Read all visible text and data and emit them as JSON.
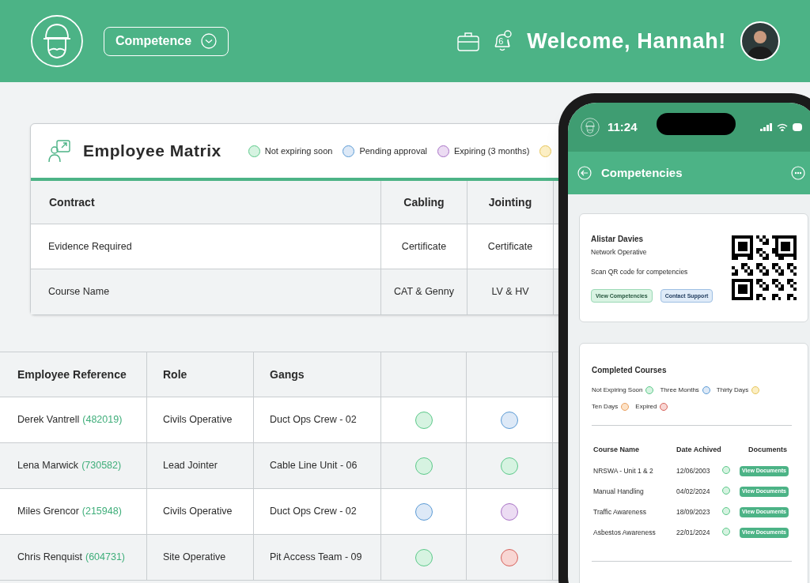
{
  "header": {
    "module_selector": {
      "label": "Competence"
    },
    "notifications": {
      "count": "6"
    },
    "greeting": "Welcome, Hannah!"
  },
  "matrix": {
    "title": "Employee Matrix",
    "legend": [
      {
        "label": "Not expiring soon",
        "color": "#d6f3e1"
      },
      {
        "label": "Pending approval",
        "color": "#dde9f7"
      },
      {
        "label": "Expiring (3 months)",
        "color": "#ecdcf3"
      },
      {
        "color": "#fcefc4"
      }
    ],
    "columns": [
      "Contract",
      "Cabling",
      "Jointing"
    ],
    "rows": [
      {
        "cells": [
          "Evidence Required",
          "Certificate",
          "Certificate"
        ]
      },
      {
        "cells": [
          "Course Name",
          "CAT & Genny",
          "LV & HV"
        ]
      }
    ]
  },
  "employees": {
    "columns": [
      "Employee Reference",
      "Role",
      "Gangs"
    ],
    "rows": [
      {
        "name": "Derek Vantrell",
        "ref": "(482019)",
        "role": "Civils Operative",
        "gang": "Duct Ops Crew - 02",
        "statuses": [
          {
            "color": "#d6f3e1"
          },
          {
            "color": "#dde9f7"
          }
        ]
      },
      {
        "name": "Lena Marwick",
        "ref": "(730582)",
        "role": "Lead Jointer",
        "gang": "Cable Line Unit - 06",
        "statuses": [
          {
            "color": "#d6f3e1"
          },
          {
            "color": "#d6f3e1"
          }
        ]
      },
      {
        "name": "Miles Grencor",
        "ref": "(215948)",
        "role": "Civils Operative",
        "gang": "Duct Ops Crew - 02",
        "statuses": [
          {
            "color": "#dde9f7"
          },
          {
            "color": "#ecdcf3"
          }
        ]
      },
      {
        "name": "Chris Renquist",
        "ref": "(604731)",
        "role": "Site Operative",
        "gang": "Pit Access Team - 09",
        "statuses": [
          {
            "color": "#d6f3e1"
          },
          {
            "color": "#f8d6d3"
          }
        ]
      }
    ]
  },
  "phone": {
    "time": "11:24",
    "title": "Competencies",
    "profile": {
      "name": "Alistar Davies",
      "role": "Network Operative",
      "hint": "Scan QR code for competencies",
      "buttons": [
        {
          "label": "View Competencies",
          "kind": "green"
        },
        {
          "label": "Contact Support",
          "kind": "blue"
        }
      ]
    },
    "courses": {
      "title": "Completed Courses",
      "legend": [
        {
          "label": "Not Expiring Soon",
          "color": "#d6f3e1"
        },
        {
          "label": "Three Months",
          "color": "#dde9f7"
        },
        {
          "label": "Thirty Days",
          "color": "#fcefc4"
        },
        {
          "label": "Ten Days",
          "color": "#fde2c6"
        },
        {
          "label": "Expired",
          "color": "#f8d6d3"
        }
      ],
      "columns": [
        "Course Name",
        "Date Achived",
        "Documents"
      ],
      "rows": [
        {
          "name": "NRSWA - Unit 1 & 2",
          "date": "12/06/2003",
          "color": "#d6f3e1",
          "action": "View Documents"
        },
        {
          "name": "Manual Handling",
          "date": "04/02/2024",
          "color": "#d6f3e1",
          "action": "View Documents"
        },
        {
          "name": "Traffic Awareness",
          "date": "18/09/2023",
          "color": "#d6f3e1",
          "action": "View Documents"
        },
        {
          "name": "Asbestos Awareness",
          "date": "22/01/2024",
          "color": "#d6f3e1",
          "action": "View Documents"
        }
      ]
    }
  }
}
